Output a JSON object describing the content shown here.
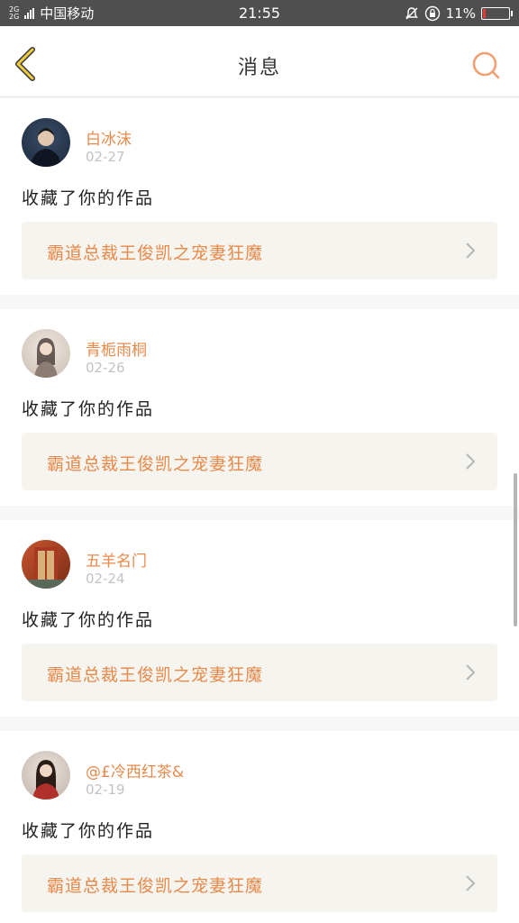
{
  "status_bar": {
    "network": "2G",
    "network2": "2G",
    "carrier": "中国移动",
    "time": "21:55",
    "battery": "11%",
    "battery_level": 0.11
  },
  "header": {
    "title": "消息",
    "back_icon": "chevron-left-icon",
    "search_icon": "search-icon",
    "accent_color": "#e8894a"
  },
  "messages": [
    {
      "username": "白冰沫",
      "date": "02-27",
      "action": "收藏了你的作品",
      "work_title": "霸道总裁王俊凯之宠妻狂魔",
      "avatar_colors": [
        "#1b2a3d",
        "#3a4d66"
      ]
    },
    {
      "username": "青栀雨桐",
      "date": "02-26",
      "action": "收藏了你的作品",
      "work_title": "霸道总裁王俊凯之宠妻狂魔",
      "avatar_colors": [
        "#e6e0d8",
        "#b9a99a"
      ]
    },
    {
      "username": "五羊名门",
      "date": "02-24",
      "action": "收藏了你的作品",
      "work_title": "霸道总裁王俊凯之宠妻狂魔",
      "avatar_colors": [
        "#8a3a1f",
        "#c8552e"
      ]
    },
    {
      "username": "@£冷西红茶&",
      "date": "02-19",
      "action": "收藏了你的作品",
      "work_title": "霸道总裁王俊凯之宠妻狂魔",
      "avatar_colors": [
        "#d9cfc8",
        "#b0302c"
      ]
    }
  ]
}
